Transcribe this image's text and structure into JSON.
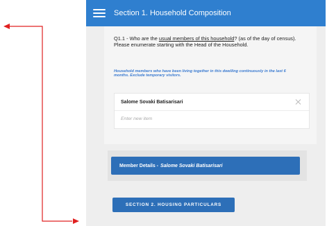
{
  "header": {
    "title": "Section 1. Household Composition",
    "menu_icon": "hamburger-menu-icon"
  },
  "question": {
    "prefix": "Q1.1 - Who are the ",
    "underlined": "usual members of this household",
    "suffix": "? (as of the day of census). Please enumerate starting with the Head of the Household.",
    "hint": "Household members who have been living together  in this dwelling continuously in the last 6 months. Exclude temporary visitors."
  },
  "members": {
    "items": [
      "Salome Sovaki Batisarisari"
    ],
    "new_item_placeholder": "Enter new item",
    "new_item_value": ""
  },
  "member_details": {
    "label": "Member Details - ",
    "name": "Salome Sovaki Batisarisari"
  },
  "next_section": {
    "label": "SECTION 2. HOUSING PARTICULARS"
  },
  "colors": {
    "header_bg": "#2f7fcf",
    "button_bg": "#2d6fb8",
    "hint_text": "#3a7ad0",
    "annotation_arrow": "#e02020"
  }
}
